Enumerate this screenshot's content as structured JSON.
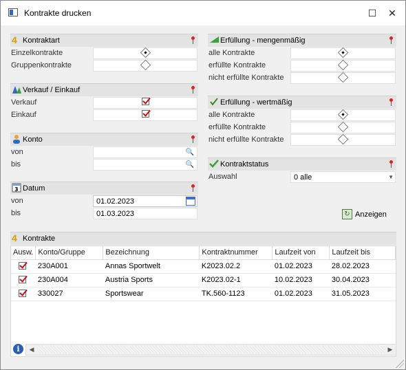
{
  "window": {
    "title": "Kontrakte drucken",
    "maximize_glyph": "☐",
    "close_glyph": "✕"
  },
  "kontraktart": {
    "title": "Kontraktart",
    "icon": "4",
    "options": [
      {
        "label": "Einzelkontrakte",
        "selected": true
      },
      {
        "label": "Gruppenkontrakte",
        "selected": false
      }
    ]
  },
  "verkauf_einkauf": {
    "title": "Verkauf / Einkauf",
    "options": [
      {
        "label": "Verkauf",
        "checked": true
      },
      {
        "label": "Einkauf",
        "checked": true
      }
    ]
  },
  "konto": {
    "title": "Konto",
    "from_label": "von",
    "to_label": "bis",
    "from_value": "",
    "to_value": ""
  },
  "datum": {
    "title": "Datum",
    "from_label": "von",
    "to_label": "bis",
    "from_value": "01.02.2023",
    "to_value": "01.03.2023"
  },
  "erfuellung_menge": {
    "title": "Erfüllung - mengenmäßig",
    "options": [
      {
        "label": "alle Kontrakte",
        "selected": true
      },
      {
        "label": "erfüllte Kontrakte",
        "selected": false
      },
      {
        "label": "nicht erfüllte Kontrakte",
        "selected": false
      }
    ]
  },
  "erfuellung_wert": {
    "title": "Erfüllung - wertmäßig",
    "options": [
      {
        "label": "alle Kontrakte",
        "selected": true
      },
      {
        "label": "erfüllte Kontrakte",
        "selected": false
      },
      {
        "label": "nicht erfüllte Kontrakte",
        "selected": false
      }
    ]
  },
  "kontraktstatus": {
    "title": "Kontraktstatus",
    "auswahl_label": "Auswahl",
    "auswahl_value": "0 alle"
  },
  "show_button": {
    "label": "Anzeigen"
  },
  "kontrakte": {
    "title": "Kontrakte",
    "columns": [
      "Ausw.",
      "Konto/Gruppe",
      "Bezeichnung",
      "Kontraktnummer",
      "Laufzeit von",
      "Laufzeit bis"
    ],
    "rows": [
      {
        "checked": true,
        "konto": "230A001",
        "bezeichnung": "Annas Sportwelt",
        "nummer": "K2023.02.2",
        "von": "01.02.2023",
        "bis": "28.02.2023"
      },
      {
        "checked": true,
        "konto": "230A004",
        "bezeichnung": "Austria Sports",
        "nummer": "K2023.02-1",
        "von": "10.02.2023",
        "bis": "30.04.2023"
      },
      {
        "checked": true,
        "konto": "330027",
        "bezeichnung": "Sportswear",
        "nummer": "TK.560-1123",
        "von": "01.02.2023",
        "bis": "31.05.2023"
      }
    ]
  },
  "colors": {
    "accent": "#2f6bbf",
    "check_red": "#d01010",
    "group_header": "#e3e3e3"
  }
}
